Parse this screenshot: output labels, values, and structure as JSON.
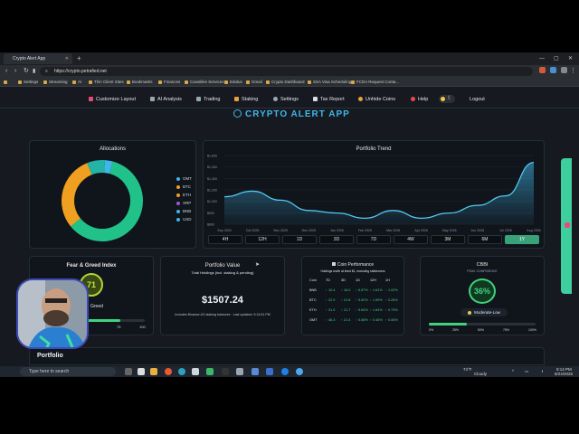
{
  "browser": {
    "tab_title": "Crypto Alert App",
    "url": "https://crypto.petrafied.net",
    "bookmarks": [
      "Settings",
      "Streaming",
      "AI",
      "Thin Client Sites",
      "Bookmarks",
      "Finances",
      "Cavalière Services",
      "Edulus",
      "Gmail",
      "Crypto Dashboard",
      "SSA Visa Scheduling",
      "FCDA Request Conta..."
    ]
  },
  "app": {
    "nav": [
      "Customize Layout",
      "AI Analysis",
      "Trading",
      "Staking",
      "Settings",
      "Tax Report",
      "Unhide Coins",
      "Help",
      "Logout"
    ],
    "title": "CRYPTO ALERT APP"
  },
  "allocations": {
    "title": "Allocations",
    "legend": [
      {
        "label": "OMT",
        "color": "#3fb6e8"
      },
      {
        "label": "BTC",
        "color": "#f0a020"
      },
      {
        "label": "ETH",
        "color": "#f0a020"
      },
      {
        "label": "XRP",
        "color": "#9b59d0"
      },
      {
        "label": "BNB",
        "color": "#3fb6e8"
      },
      {
        "label": "USD",
        "color": "#3fb6e8"
      }
    ]
  },
  "portfolio_trend": {
    "title": "Portfolio Trend",
    "timeframes": [
      "4H",
      "12H",
      "1D",
      "3D",
      "7D",
      "4W",
      "3M",
      "6M",
      "1Y"
    ],
    "active_timeframe": "1Y"
  },
  "chart_data": {
    "type": "area",
    "title": "Portfolio Trend",
    "x": [
      "Sep 2025",
      "Oct 2025",
      "Nov 2025",
      "Dec 2025",
      "Jan 2026",
      "Feb 2026",
      "Mar 2026",
      "Apr 2026",
      "May 2026",
      "Jun 2026",
      "Jul 2026",
      "Aug 2026"
    ],
    "y_ticks": [
      "$1,600",
      "$1,400",
      "$1,300",
      "$1,200",
      "$1,000",
      "$900",
      "$800"
    ],
    "series": [
      {
        "values": [
          1120,
          1185,
          1080,
          960,
          930,
          870,
          960,
          870,
          930,
          1020,
          1130,
          1520
        ]
      }
    ],
    "ylim": [
      800,
      1600
    ]
  },
  "fear_greed": {
    "title": "Fear & Greed Index",
    "value": "71",
    "label": "Greed",
    "scale": [
      "75",
      "100"
    ]
  },
  "portfolio_value": {
    "title": "Portfolio Value",
    "subtitle": "Total Holdings (incl. staking & pending)",
    "value": "$1507.24",
    "footnote": "Includes Binance.US staking balances · Last updated: 9:14:51 PM"
  },
  "coin_performance": {
    "title": "Coin Performance",
    "subtitle": "Holdings worth at least $1, excluding stablecoins",
    "columns": [
      "Coin",
      "7D",
      "3D",
      "1D",
      "12H",
      "1H"
    ],
    "rows": [
      [
        "BNB",
        "↑ 10.4",
        "↑ 16.0",
        "↑ 6.87%",
        "↑ 1.61%",
        "↑ 1.02%"
      ],
      [
        "BTC",
        "↑ 22.9",
        "↑ 21.8",
        "↑ 5.62%",
        "↑ 1.99%",
        "↑ 0.26%"
      ],
      [
        "ETH",
        "↑ 31.9",
        "↑ 21.7",
        "↑ 5.64%",
        "↑ 1.64%",
        "↑ 0.73%"
      ],
      [
        "OMT",
        "↑ 46.3",
        "↑ 21.4",
        "↑ 5.68%",
        "↑ 0.46%",
        "↑ 0.06%"
      ]
    ]
  },
  "cbbi": {
    "title": "CBBI",
    "subtitle": "PEAK CONFIDENCE",
    "value": "36%",
    "label": "Moderate-Low",
    "scale": [
      "0%",
      "25%",
      "50%",
      "75%",
      "100%"
    ],
    "fraction": 0.36
  },
  "portfolio_section": {
    "title": "Portfolio"
  },
  "taskbar": {
    "search_placeholder": "Type here to search",
    "weather_temp": "74°F",
    "weather_desc": "Cloudy",
    "time": "9:14 PM",
    "date": "8/24/2026"
  }
}
